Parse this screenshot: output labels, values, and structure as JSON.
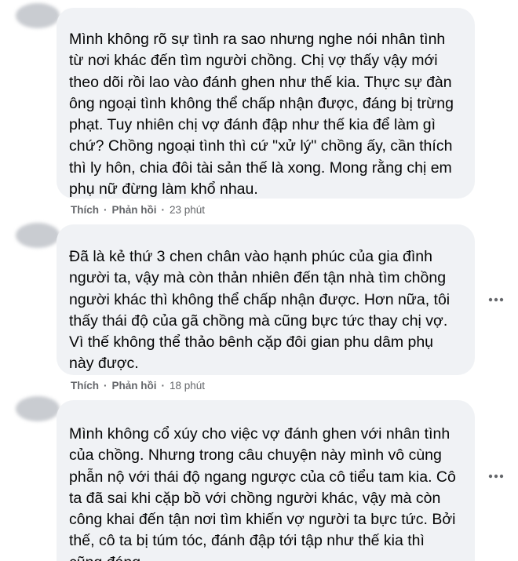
{
  "comments": [
    {
      "text": "Mình không rõ sự tình ra sao nhưng nghe nói nhân tình\ntừ nơi khác đến tìm người chồng. Chị vợ thấy vậy mới\ntheo dõi rồi lao vào đánh ghen như thế kia. Thực sự đàn\nông ngoại tình không thể chấp nhận được, đáng bị trừng\nphạt. Tuy nhiên chị vợ đánh đập như thế kia để làm gì\nchứ? Chồng ngoại tình thì cứ \"xử lý\" chồng ấy, cần thích\nthì ly hôn, chia đôi tài sản thế là xong. Mong rằng chị em\nphụ nữ đừng làm khổ nhau.",
      "like_label": "Thích",
      "reply_label": "Phản hồi",
      "time": "23 phút"
    },
    {
      "text": "Đã là kẻ thứ 3 chen chân vào hạnh phúc của gia đình\nngười ta, vậy mà còn thản nhiên đến tận nhà tìm chồng\nngười khác thì không thể chấp nhận được. Hơn nữa, tôi\nthấy thái độ của gã chồng mà cũng bực tức thay chị vợ.\nVì thế không thể thảo bênh cặp đôi gian phu dâm phụ\nnày được.",
      "like_label": "Thích",
      "reply_label": "Phản hồi",
      "time": "18 phút"
    },
    {
      "text": "Mình không cổ xúy cho việc vợ đánh ghen với nhân tình\ncủa chồng. Nhưng trong câu chuyện này mình vô cùng\nphẫn nộ với thái độ ngang ngược của cô tiểu tam kia. Cô\nta đã sai khi cặp bồ với chồng người khác, vậy mà còn\ncông khai đến tận nơi tìm khiến vợ người ta bực tức. Bởi\nthế, cô ta bị túm tóc, đánh đập tới tập như thế kia thì\ncũng đáng."
    }
  ],
  "separator": "·",
  "more_icon": "more-horizontal-icon"
}
